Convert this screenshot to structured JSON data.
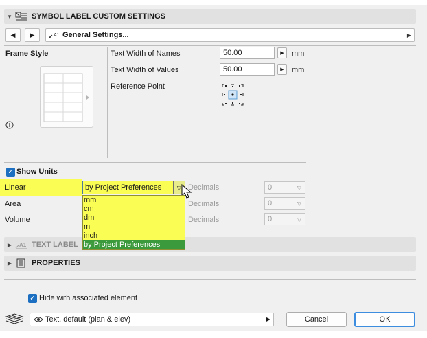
{
  "sections": {
    "symbol_label": "SYMBOL LABEL CUSTOM SETTINGS",
    "text_label": "TEXT LABEL",
    "properties": "PROPERTIES"
  },
  "nav": {
    "prev_icon": "triangle-left-icon",
    "next_icon": "triangle-right-icon",
    "page_label": "General Settings..."
  },
  "frame": {
    "title": "Frame Style",
    "info_icon": "info-circle-icon"
  },
  "text_width": {
    "names_label": "Text Width of Names",
    "names_value": "50.00",
    "values_label": "Text Width of Values",
    "values_value": "50.00",
    "unit": "mm"
  },
  "reference_point": {
    "label": "Reference Point"
  },
  "units": {
    "show_units_label": "Show Units",
    "show_units_checked": true,
    "rows": [
      {
        "label": "Linear",
        "value": "by Project Preferences",
        "decimals_label": "Decimals",
        "decimals_value": "0"
      },
      {
        "label": "Area",
        "value": "",
        "decimals_label": "Decimals",
        "decimals_value": "0"
      },
      {
        "label": "Volume",
        "value": "",
        "decimals_label": "Decimals",
        "decimals_value": "0"
      }
    ],
    "dropdown_options": [
      "mm",
      "cm",
      "dm",
      "m",
      "inch",
      "by Project Preferences"
    ],
    "selected_option": "by Project Preferences"
  },
  "footer": {
    "hide_label": "Hide with associated element",
    "hide_checked": true,
    "layer_value": "Text, default (plan & elev)",
    "cancel_label": "Cancel",
    "ok_label": "OK"
  },
  "colors": {
    "highlight": "#fafd54",
    "selected_option": "#3b9a3b",
    "checkbox_accent": "#1d6fc2"
  }
}
